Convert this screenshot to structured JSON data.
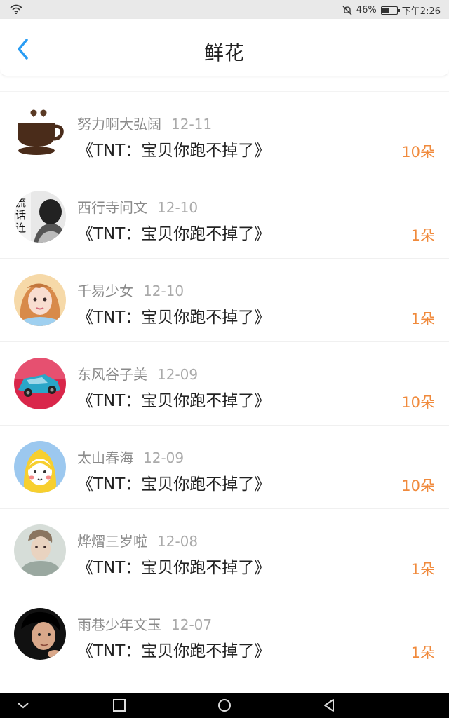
{
  "status": {
    "battery": "46%",
    "battery_level": 0.46,
    "time": "下午2:26"
  },
  "header": {
    "title": "鲜花"
  },
  "records": [
    {
      "user": "努力啊大弘阔",
      "date": "12-11",
      "message": "《TNT：宝贝你跑不掉了》",
      "count": "10朵"
    },
    {
      "user": "西行寺问文",
      "date": "12-10",
      "message": "《TNT：宝贝你跑不掉了》",
      "count": "1朵"
    },
    {
      "user": "千易少女",
      "date": "12-10",
      "message": "《TNT：宝贝你跑不掉了》",
      "count": "1朵"
    },
    {
      "user": "东风谷子美",
      "date": "12-09",
      "message": "《TNT：宝贝你跑不掉了》",
      "count": "10朵"
    },
    {
      "user": "太山春海",
      "date": "12-09",
      "message": "《TNT：宝贝你跑不掉了》",
      "count": "10朵"
    },
    {
      "user": "烨熠三岁啦",
      "date": "12-08",
      "message": "《TNT：宝贝你跑不掉了》",
      "count": "1朵"
    },
    {
      "user": "雨巷少年文玉",
      "date": "12-07",
      "message": "《TNT：宝贝你跑不掉了》",
      "count": "1朵"
    }
  ],
  "colors": {
    "accent_back": "#2a9df4",
    "count": "#f08a3c"
  }
}
